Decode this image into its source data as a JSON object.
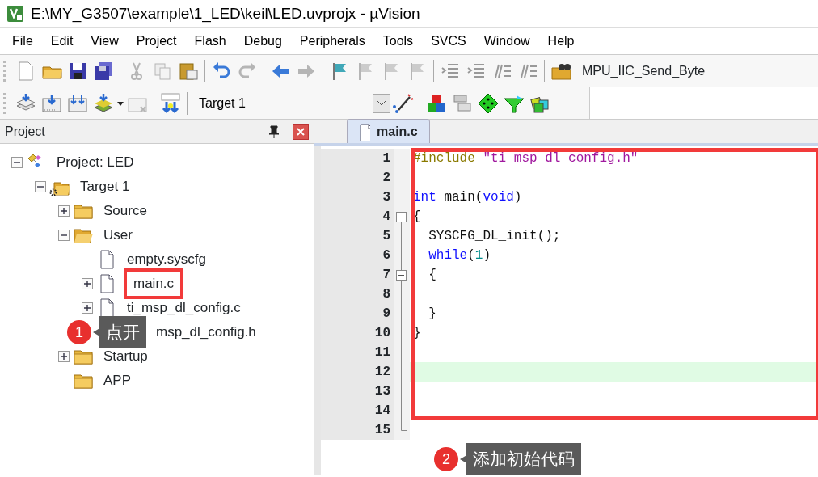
{
  "window": {
    "title": "E:\\MY_G3507\\example\\1_LED\\keil\\LED.uvprojx - µVision"
  },
  "menu": [
    "File",
    "Edit",
    "View",
    "Project",
    "Flash",
    "Debug",
    "Peripherals",
    "Tools",
    "SVCS",
    "Window",
    "Help"
  ],
  "toolbar": {
    "find_combo": "MPU_IIC_Send_Byte"
  },
  "build_toolbar": {
    "target": "Target 1"
  },
  "project_panel": {
    "title": "Project",
    "tree": [
      {
        "label": "Project: LED",
        "kind": "project",
        "expanded": true,
        "children": [
          {
            "label": "Target 1",
            "kind": "target",
            "expanded": true,
            "children": [
              {
                "label": "Source",
                "kind": "group",
                "expanded": false
              },
              {
                "label": "User",
                "kind": "group",
                "expanded": true,
                "children": [
                  {
                    "label": "empty.syscfg",
                    "kind": "file",
                    "highlighted": false
                  },
                  {
                    "label": "main.c",
                    "kind": "file",
                    "expanded": false,
                    "highlighted": true
                  },
                  {
                    "label": "ti_msp_dl_config.c",
                    "kind": "file",
                    "expanded": false,
                    "highlighted": false
                  },
                  {
                    "label": "msp_dl_config.h",
                    "kind": "file",
                    "highlighted": false,
                    "callout": {
                      "number": "1",
                      "text": "点开"
                    }
                  }
                ]
              },
              {
                "label": "Startup",
                "kind": "group",
                "expanded": false
              },
              {
                "label": "APP",
                "kind": "group"
              }
            ]
          }
        ]
      }
    ]
  },
  "editor": {
    "tabs": [
      {
        "label": "main.c",
        "selected": true
      }
    ],
    "lines": [
      {
        "number": "1",
        "tokens": [
          {
            "kind": "preproc",
            "text": "#include"
          },
          {
            "kind": "string",
            "text": " \"ti_msp_dl_config.h\""
          }
        ]
      },
      {
        "number": "2"
      },
      {
        "number": "3",
        "tokens": [
          {
            "kind": "keyword",
            "text": "int"
          },
          {
            "kind": "plain",
            "text": " main("
          },
          {
            "kind": "keyword",
            "text": "void"
          },
          {
            "kind": "plain",
            "text": ")"
          }
        ]
      },
      {
        "number": "4",
        "fold_start": true,
        "tokens": [
          {
            "kind": "plain",
            "text": "{"
          }
        ]
      },
      {
        "number": "5",
        "tokens": [
          {
            "kind": "plain",
            "text": "  SYSCFG_DL_init();"
          }
        ]
      },
      {
        "number": "6",
        "tokens": [
          {
            "kind": "keyword",
            "text": "  while"
          },
          {
            "kind": "plain",
            "text": "("
          },
          {
            "kind": "number",
            "text": "1"
          },
          {
            "kind": "plain",
            "text": ")"
          }
        ]
      },
      {
        "number": "7",
        "fold_start": true,
        "tokens": [
          {
            "kind": "plain",
            "text": "  {"
          }
        ]
      },
      {
        "number": "8"
      },
      {
        "number": "9",
        "fold_end": true,
        "tokens": [
          {
            "kind": "plain",
            "text": "  }"
          }
        ]
      },
      {
        "number": "10",
        "tokens": [
          {
            "kind": "plain",
            "text": "}"
          }
        ]
      },
      {
        "number": "11"
      },
      {
        "number": "12",
        "current": true
      },
      {
        "number": "13"
      },
      {
        "number": "14"
      },
      {
        "number": "15",
        "fold_end": true
      }
    ],
    "callout": {
      "number": "2",
      "text": "添加初始代码"
    }
  }
}
